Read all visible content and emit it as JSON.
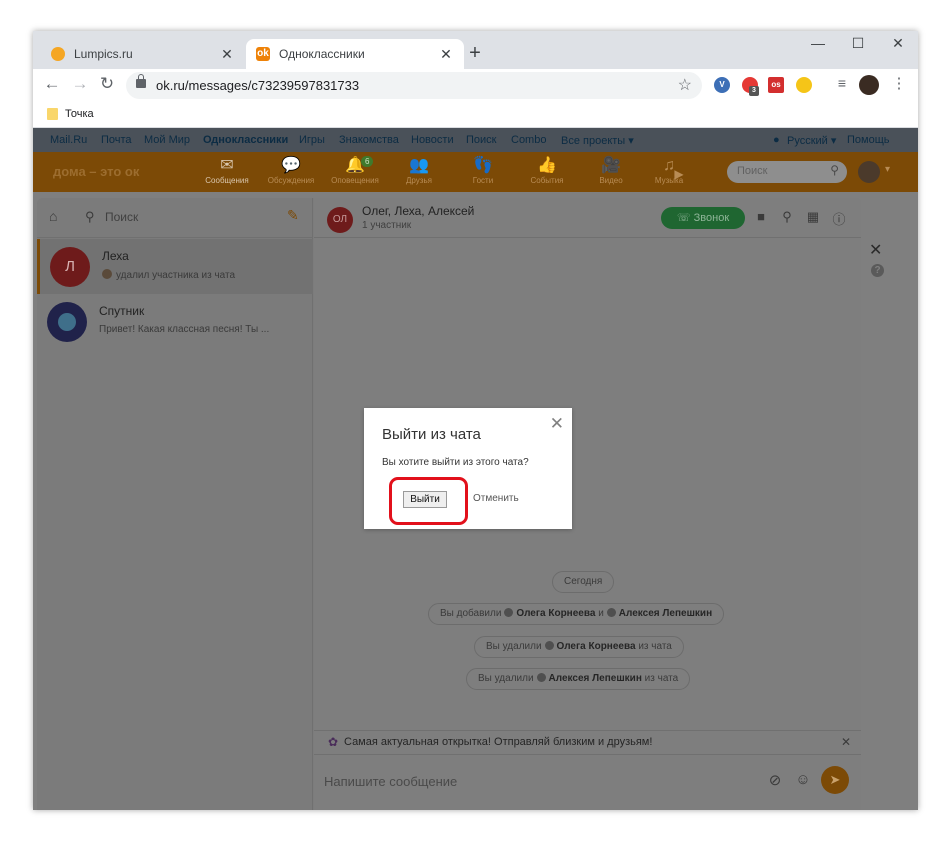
{
  "browser": {
    "tabs": [
      {
        "title": "Lumpics.ru",
        "close": "✕"
      },
      {
        "title": "Одноклассники",
        "close": "✕"
      }
    ],
    "new_tab": "+",
    "window_controls": {
      "minimize": "—",
      "maximize": "☐",
      "close": "✕"
    },
    "url": "ok.ru/messages/c73239597831733",
    "extension_badge": "3",
    "bookmark": "Точка"
  },
  "portal_bar": {
    "links": [
      "Mail.Ru",
      "Почта",
      "Мой Мир",
      "Одноклассники",
      "Игры",
      "Знакомства",
      "Новости",
      "Поиск",
      "Combo",
      "Все проекты ▾"
    ],
    "language": "Русский ▾",
    "help": "Помощь"
  },
  "ok_nav": {
    "logo": "дома – это ок",
    "items": [
      {
        "label": "Сообщения",
        "icon": "✉"
      },
      {
        "label": "Обсуждения",
        "icon": "💬"
      },
      {
        "label": "Оповещения",
        "icon": "🔔",
        "badge": "6"
      },
      {
        "label": "Друзья",
        "icon": "👥"
      },
      {
        "label": "Гости",
        "icon": "👣"
      },
      {
        "label": "События",
        "icon": "👍"
      },
      {
        "label": "Видео",
        "icon": "🎥"
      },
      {
        "label": "Музыка",
        "icon": "♫"
      }
    ],
    "search_placeholder": "Поиск"
  },
  "messenger": {
    "search_placeholder": "Поиск",
    "chats": [
      {
        "avatar": "Л",
        "name": "Леха",
        "preview": "удалил участника из чата",
        "avatar_color": "#6e1b1b"
      },
      {
        "avatar": "",
        "name": "Спутник",
        "preview": "Привет! Какая классная песня! Ты ...",
        "avatar_color": "#20224a"
      }
    ],
    "active_chat": {
      "avatar": "ОЛ",
      "title": "Олег, Леха, Алексей",
      "subtitle": "1 участник",
      "call_label": "Звонок"
    },
    "date_pill": "Сегодня",
    "events": [
      {
        "prefix": "Вы добавили",
        "name1": "Олега Корнеева",
        "joiner": "и",
        "name2": "Алексея Лепешкин"
      },
      {
        "prefix": "Вы удалили",
        "name1": "Олега Корнеева",
        "suffix": "из чата"
      },
      {
        "prefix": "Вы удалили",
        "name1": "Алексея Лепешкин",
        "suffix": "из чата"
      }
    ],
    "promo": "Самая актуальная открытка! Отправляй близким и друзьям!",
    "composer_placeholder": "Напишите сообщение"
  },
  "dialog": {
    "title": "Выйти из чата",
    "text": "Вы хотите выйти из этого чата?",
    "confirm": "Выйти",
    "cancel": "Отменить",
    "close": "✕"
  },
  "colors": {
    "ok_orange": "#ee8208",
    "highlight": "#e2101b"
  }
}
